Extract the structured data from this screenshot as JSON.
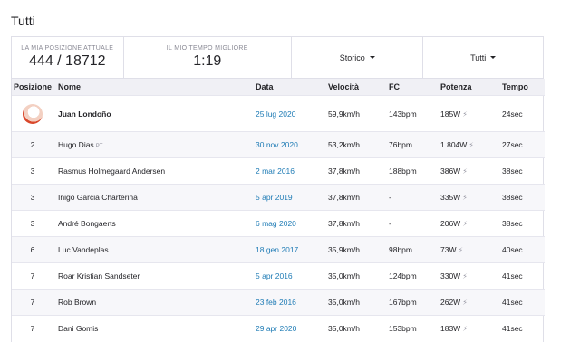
{
  "page": {
    "title": "Tutti"
  },
  "summary": {
    "position_label": "LA MIA POSIZIONE ATTUALE",
    "position_value": "444 / 18712",
    "best_label": "IL MIO TEMPO MIGLIORE",
    "best_value": "1:19",
    "history_label": "Storico",
    "filter_label": "Tutti"
  },
  "table": {
    "headers": [
      "Posizione",
      "Nome",
      "Data",
      "Velocità",
      "FC",
      "Potenza",
      "Tempo"
    ],
    "rows": [
      {
        "pos": "",
        "name": "Juan Londoño",
        "badge": "",
        "date": "25 lug 2020",
        "speed": "59,9km/h",
        "hr": "143bpm",
        "power": "185W",
        "time": "24sec"
      },
      {
        "pos": "2",
        "name": "Hugo Dias",
        "badge": "PT",
        "date": "30 nov 2020",
        "speed": "53,2km/h",
        "hr": "76bpm",
        "power": "1.804W",
        "time": "27sec"
      },
      {
        "pos": "3",
        "name": "Rasmus Holmegaard Andersen",
        "badge": "",
        "date": "2 mar 2016",
        "speed": "37,8km/h",
        "hr": "188bpm",
        "power": "386W",
        "time": "38sec"
      },
      {
        "pos": "3",
        "name": "Iñigo Garcia Charterina",
        "badge": "",
        "date": "5 apr 2019",
        "speed": "37,8km/h",
        "hr": "-",
        "power": "335W",
        "time": "38sec"
      },
      {
        "pos": "3",
        "name": "André Bongaerts",
        "badge": "",
        "date": "6 mag 2020",
        "speed": "37,8km/h",
        "hr": "-",
        "power": "206W",
        "time": "38sec"
      },
      {
        "pos": "6",
        "name": "Luc Vandeplas",
        "badge": "",
        "date": "18 gen 2017",
        "speed": "35,9km/h",
        "hr": "98bpm",
        "power": "73W",
        "time": "40sec"
      },
      {
        "pos": "7",
        "name": "Roar Kristian Sandseter",
        "badge": "",
        "date": "5 apr 2016",
        "speed": "35,0km/h",
        "hr": "124bpm",
        "power": "330W",
        "time": "41sec"
      },
      {
        "pos": "7",
        "name": "Rob Brown",
        "badge": "",
        "date": "23 feb 2016",
        "speed": "35,0km/h",
        "hr": "167bpm",
        "power": "262W",
        "time": "41sec"
      },
      {
        "pos": "7",
        "name": "Dani Gomis",
        "badge": "",
        "date": "29 apr 2020",
        "speed": "35,0km/h",
        "hr": "153bpm",
        "power": "183W",
        "time": "41sec"
      }
    ]
  },
  "colors": {
    "link": "#1e7bb5",
    "header_bg": "#f0f0f5",
    "alt_row": "#f7f7fa"
  },
  "icons": {
    "power": "lightning-icon",
    "dropdown": "caret-down-icon",
    "first_place": "kom-avatar-icon"
  }
}
